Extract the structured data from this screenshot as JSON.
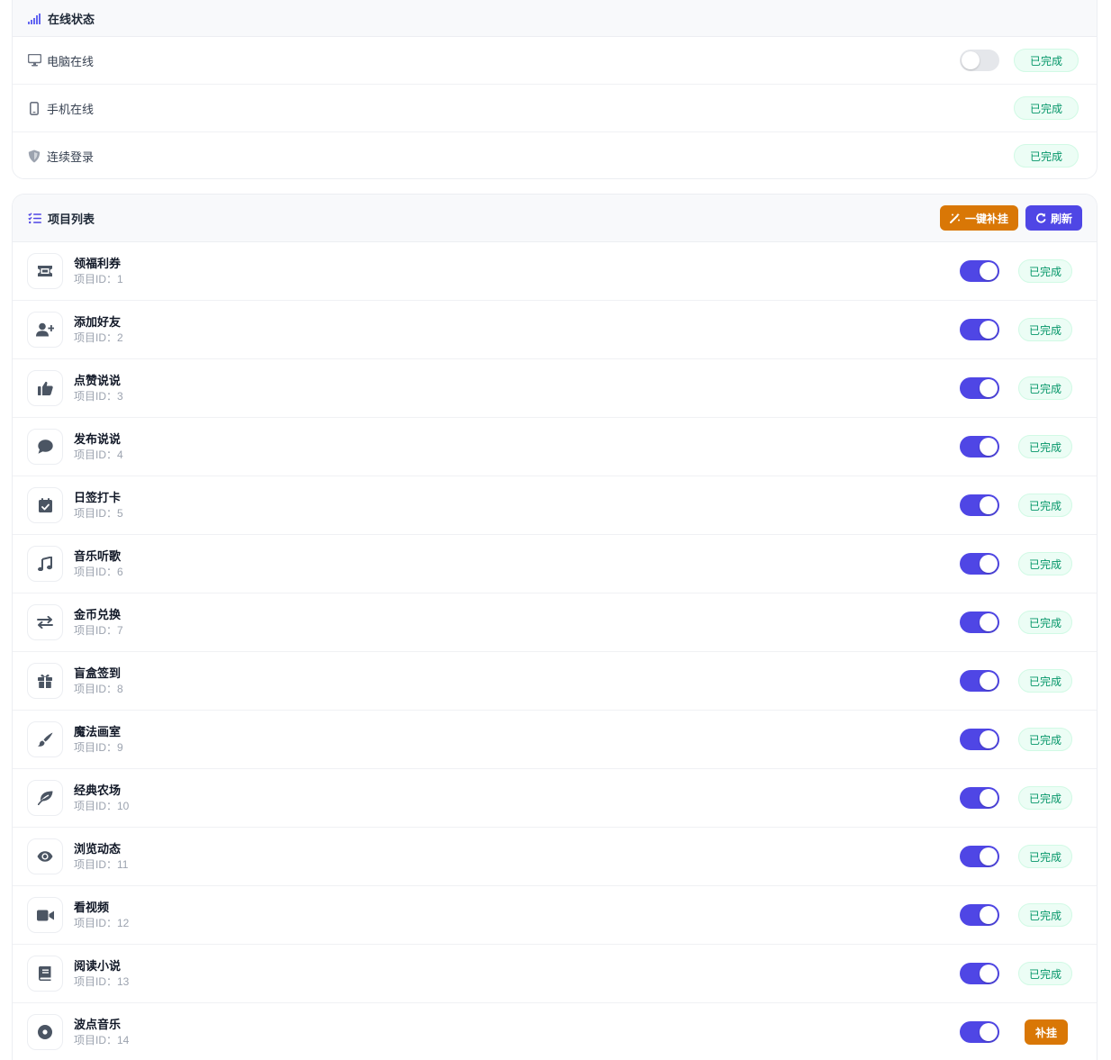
{
  "online_status": {
    "title": "在线状态",
    "title_icon": "signal-icon",
    "rows": [
      {
        "label": "电脑在线",
        "icon": "desktop-icon",
        "toggle": false,
        "has_toggle": true,
        "status": "已完成"
      },
      {
        "label": "手机在线",
        "icon": "mobile-icon",
        "has_toggle": false,
        "status": "已完成"
      },
      {
        "label": "连续登录",
        "icon": "shield-icon",
        "has_toggle": false,
        "status": "已完成"
      }
    ]
  },
  "project_list": {
    "title": "项目列表",
    "title_icon": "list-check-icon",
    "rehang_all_label": "一键补挂",
    "refresh_label": "刷新",
    "items": [
      {
        "name": "领福利券",
        "id_label": "项目ID：1",
        "icon": "ticket-icon",
        "enabled": true,
        "status": "已完成"
      },
      {
        "name": "添加好友",
        "id_label": "项目ID：2",
        "icon": "user-plus-icon",
        "enabled": true,
        "status": "已完成"
      },
      {
        "name": "点赞说说",
        "id_label": "项目ID：3",
        "icon": "thumbs-up-icon",
        "enabled": true,
        "status": "已完成"
      },
      {
        "name": "发布说说",
        "id_label": "项目ID：4",
        "icon": "comment-icon",
        "enabled": true,
        "status": "已完成"
      },
      {
        "name": "日签打卡",
        "id_label": "项目ID：5",
        "icon": "calendar-check-icon",
        "enabled": true,
        "status": "已完成"
      },
      {
        "name": "音乐听歌",
        "id_label": "项目ID：6",
        "icon": "music-icon",
        "enabled": true,
        "status": "已完成"
      },
      {
        "name": "金币兑换",
        "id_label": "项目ID：7",
        "icon": "exchange-icon",
        "enabled": true,
        "status": "已完成"
      },
      {
        "name": "盲盒签到",
        "id_label": "项目ID：8",
        "icon": "gift-icon",
        "enabled": true,
        "status": "已完成"
      },
      {
        "name": "魔法画室",
        "id_label": "项目ID：9",
        "icon": "paint-brush-icon",
        "enabled": true,
        "status": "已完成"
      },
      {
        "name": "经典农场",
        "id_label": "项目ID：10",
        "icon": "leaf-icon",
        "enabled": true,
        "status": "已完成"
      },
      {
        "name": "浏览动态",
        "id_label": "项目ID：11",
        "icon": "eye-icon",
        "enabled": true,
        "status": "已完成"
      },
      {
        "name": "看视频",
        "id_label": "项目ID：12",
        "icon": "video-icon",
        "enabled": true,
        "status": "已完成"
      },
      {
        "name": "阅读小说",
        "id_label": "项目ID：13",
        "icon": "book-icon",
        "enabled": true,
        "status": "已完成"
      },
      {
        "name": "波点音乐",
        "id_label": "项目ID：14",
        "icon": "record-icon",
        "enabled": true,
        "status": "补挂"
      }
    ]
  },
  "colors": {
    "accent": "#4f46e5",
    "warning": "#d97706",
    "success_text": "#059669",
    "success_bg": "#ecfdf5",
    "icon_gray": "#4b5563"
  }
}
